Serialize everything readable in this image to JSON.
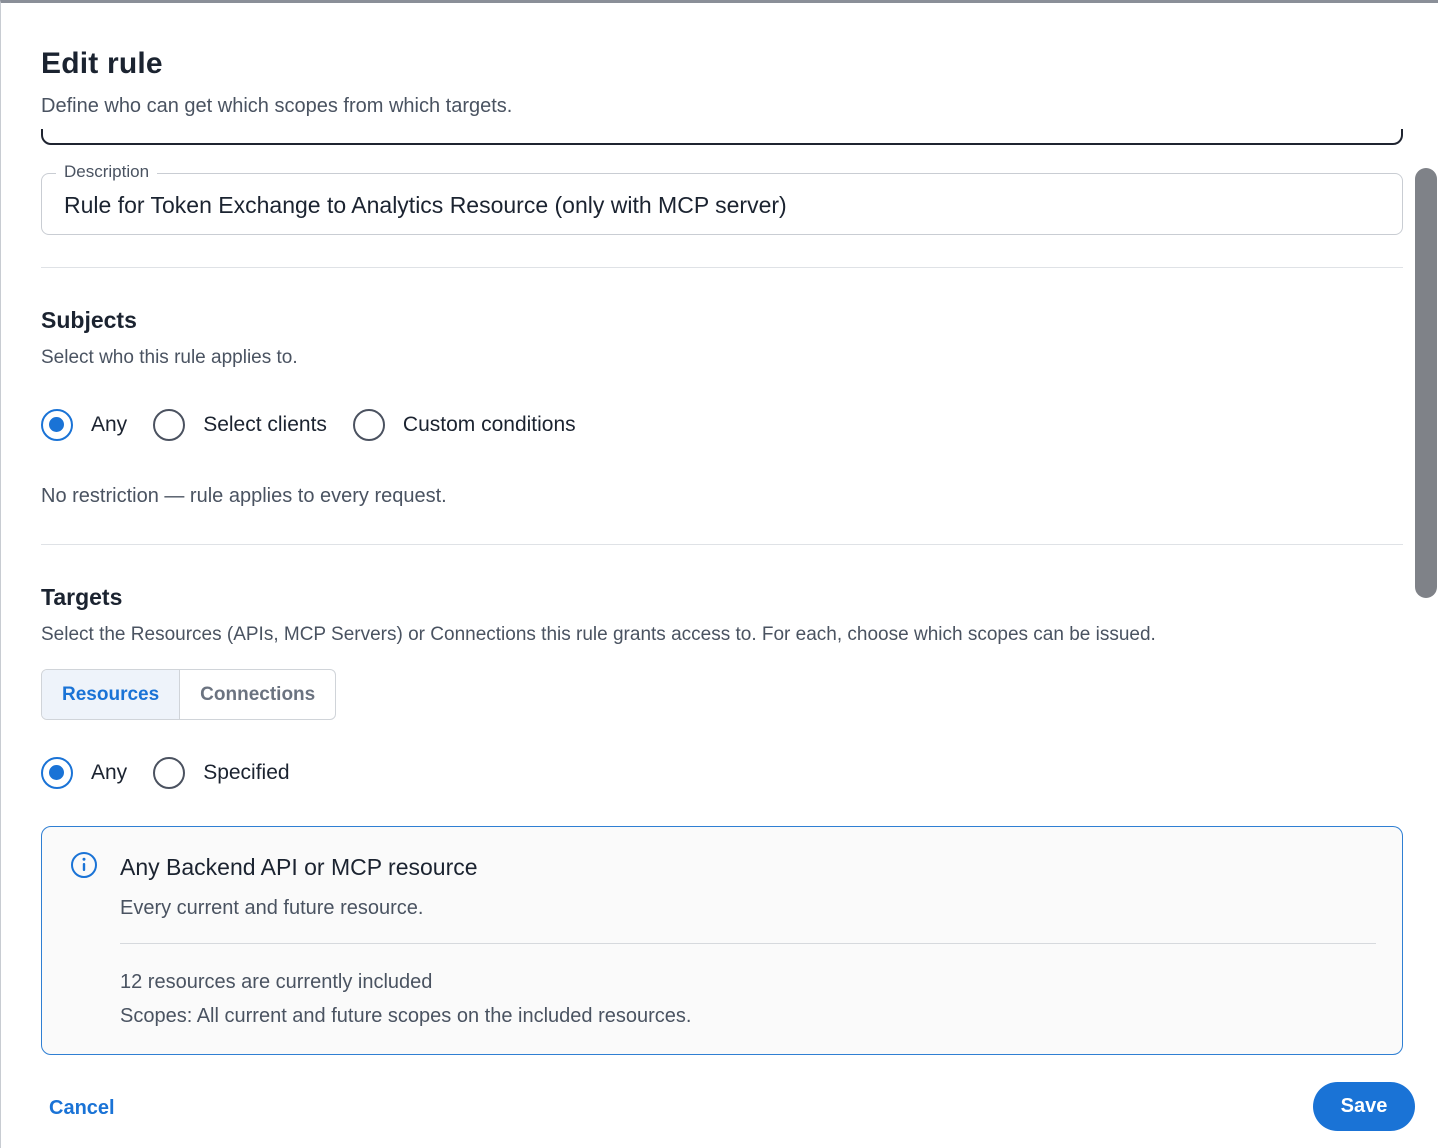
{
  "dialog": {
    "title": "Edit rule",
    "subtitle": "Define who can get which scopes from which targets."
  },
  "description_field": {
    "label": "Description",
    "value": "Rule for Token Exchange to Analytics Resource (only with MCP server)"
  },
  "subjects": {
    "title": "Subjects",
    "description": "Select who this rule applies to.",
    "options": [
      {
        "label": "Any",
        "selected": true
      },
      {
        "label": "Select clients",
        "selected": false
      },
      {
        "label": "Custom conditions",
        "selected": false
      }
    ],
    "note": "No restriction — rule applies to every request."
  },
  "targets": {
    "title": "Targets",
    "description": "Select the Resources (APIs, MCP Servers) or Connections this rule grants access to. For each, choose which scopes can be issued.",
    "tabs": [
      {
        "label": "Resources",
        "active": true
      },
      {
        "label": "Connections",
        "active": false
      }
    ],
    "options": [
      {
        "label": "Any",
        "selected": true
      },
      {
        "label": "Specified",
        "selected": false
      }
    ],
    "info": {
      "icon": "info-icon",
      "title": "Any Backend API or MCP resource",
      "subtitle": "Every current and future resource.",
      "count_text": "12 resources are currently included",
      "scopes_text": "Scopes: All current and future scopes on the included resources."
    }
  },
  "footer": {
    "cancel_label": "Cancel",
    "save_label": "Save"
  },
  "colors": {
    "accent": "#1a73d6",
    "text_primary": "#1b2330",
    "text_secondary": "#4a5361",
    "info_border": "#2f7fd3"
  }
}
